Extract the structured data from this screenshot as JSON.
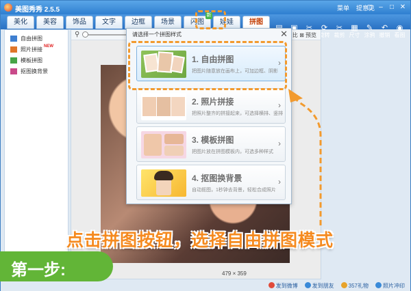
{
  "window": {
    "title": "美图秀秀 2.5.5",
    "title_links": [
      "菜单",
      "提意见"
    ],
    "controls": [
      "◻",
      "–",
      "□",
      "✕"
    ]
  },
  "tabs": [
    {
      "label": "美化"
    },
    {
      "label": "美容"
    },
    {
      "label": "饰品"
    },
    {
      "label": "文字"
    },
    {
      "label": "边框"
    },
    {
      "label": "场景"
    },
    {
      "label": "闪图",
      "badge": "新"
    },
    {
      "label": "娃娃"
    },
    {
      "label": "拼图",
      "active": true
    }
  ],
  "tools": [
    {
      "icon": "open-icon",
      "glyph": "▤",
      "label": "打开"
    },
    {
      "icon": "save-icon",
      "glyph": "▣",
      "label": "保存"
    },
    {
      "icon": "crop-icon",
      "glyph": "✂",
      "label": "抠图"
    },
    {
      "icon": "rotate-icon",
      "glyph": "⟳",
      "label": "旋转"
    },
    {
      "icon": "cut-icon",
      "glyph": "✂",
      "label": "裁剪"
    },
    {
      "icon": "size-icon",
      "glyph": "▦",
      "label": "尺寸"
    },
    {
      "icon": "eraser-icon",
      "glyph": "✎",
      "label": "涂鸦"
    },
    {
      "icon": "undo-icon",
      "glyph": "↶",
      "label": "撤销"
    },
    {
      "icon": "view-icon",
      "glyph": "◉",
      "label": "看图"
    }
  ],
  "left_panel": {
    "items": [
      {
        "label": "自由拼图",
        "color": "#3f7fd0"
      },
      {
        "label": "照片拼接",
        "color": "#e0762a",
        "new": "NEW"
      },
      {
        "label": "模板拼图",
        "color": "#47a447"
      },
      {
        "label": "抠图换背景",
        "color": "#c94a8a"
      }
    ]
  },
  "main": {
    "preview_label": "比  ⊠ 预览",
    "dimensions": "479 × 359"
  },
  "dialog": {
    "title": "请选择一个拼图样式",
    "close": "✕",
    "modes": [
      {
        "title": "1. 自由拼图",
        "desc": "把图片随意放在画布上，可加边框、阴影",
        "selected": true
      },
      {
        "title": "2. 照片拼接",
        "desc": "把照片整齐的拼接起来，可选择横排、竖排"
      },
      {
        "title": "3. 模板拼图",
        "desc": "把图片放在拼图模板内，可选多种样式"
      },
      {
        "title": "4. 抠图换背景",
        "desc": "自动抠图，1秒钟去背景，轻松合成照片"
      }
    ]
  },
  "annotation": {
    "caption": "点击拼图按钮，选择自由拼图模式",
    "step": "第一步:"
  },
  "statusbar": [
    {
      "label": "发到微博",
      "color": "#e04a3a"
    },
    {
      "label": "发到朋友",
      "color": "#3a8ad8"
    },
    {
      "label": "357礼物",
      "color": "#e8a32a"
    },
    {
      "label": "照片冲印",
      "color": "#3a8ad8"
    }
  ],
  "colors": {
    "accent": "#f29a2e",
    "window_blue": "#2f7fd0",
    "step_green": "#62b537"
  }
}
